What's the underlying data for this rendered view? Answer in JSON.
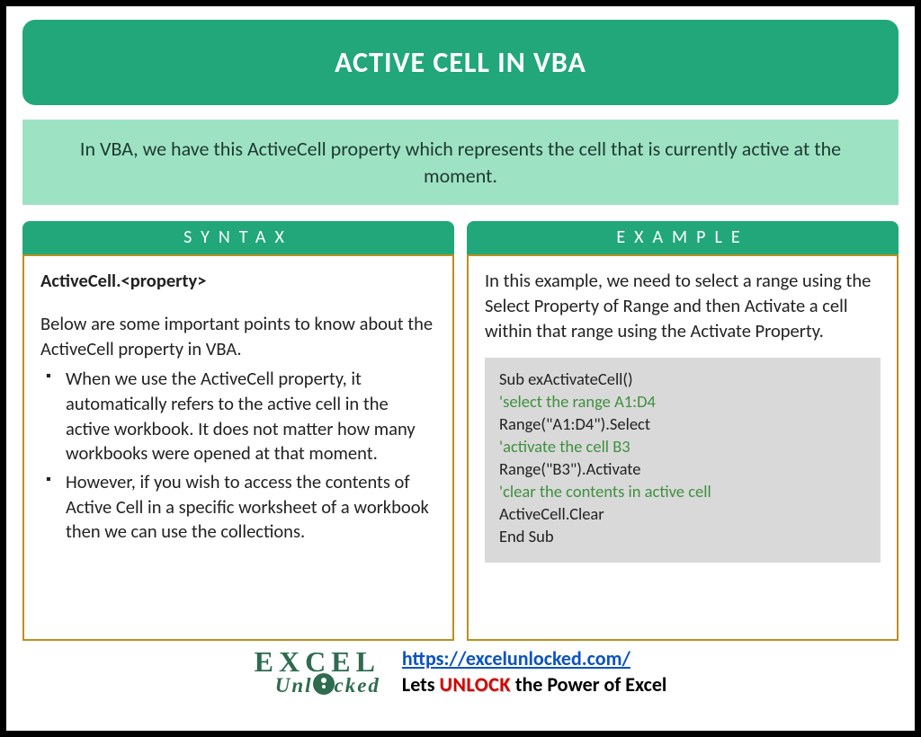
{
  "title": "ACTIVE CELL IN VBA",
  "intro": "In VBA, we have this ActiveCell property which represents the cell that is currently active at the moment.",
  "left": {
    "header": "SYNTAX",
    "signature": "ActiveCell.<property>",
    "lead": "Below are some important points to know about the ActiveCell property in VBA.",
    "bullets": [
      "When we use the ActiveCell property, it automatically refers to the active cell in the active workbook. It does not matter how many workbooks were opened at that moment.",
      "However, if you wish to access the contents of Active Cell in a specific worksheet of a workbook then we can use the collections."
    ]
  },
  "right": {
    "header": "EXAMPLE",
    "lead": "In this example, we need to select a range using the Select Property of Range and then Activate a cell within that range using the Activate Property.",
    "code": [
      {
        "t": "Sub exActivateCell()",
        "c": false
      },
      {
        "t": "'select the range A1:D4",
        "c": true
      },
      {
        "t": "Range(\"A1:D4\").Select",
        "c": false
      },
      {
        "t": "'activate the cell B3",
        "c": true
      },
      {
        "t": "Range(\"B3\").Activate",
        "c": false
      },
      {
        "t": "'clear the contents in active cell",
        "c": true
      },
      {
        "t": "ActiveCell.Clear",
        "c": false
      },
      {
        "t": "End Sub",
        "c": false
      }
    ]
  },
  "footer": {
    "logo_line1": "EXCEL",
    "logo_line2_pre": "Unl",
    "logo_line2_post": "cked",
    "url": "https://excelunlocked.com/",
    "tag_pre": "Lets ",
    "tag_hl": "UNLOCK",
    "tag_post": " the Power of Excel"
  }
}
